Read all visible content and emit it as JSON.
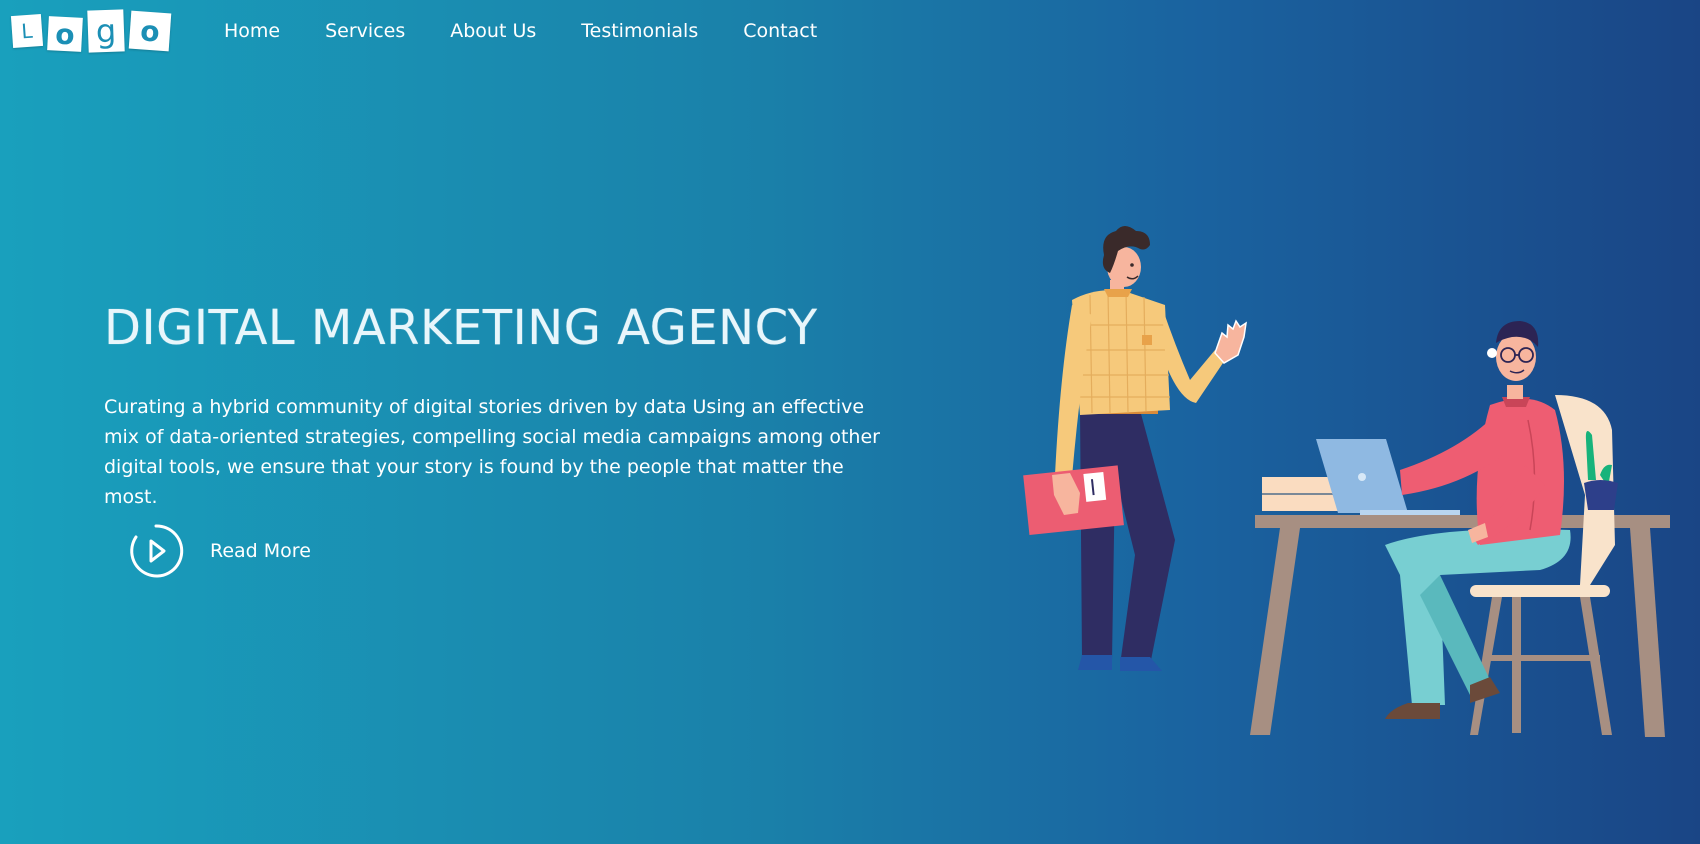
{
  "logo": {
    "letters": [
      "L",
      "o",
      "g",
      "o"
    ]
  },
  "nav": {
    "items": [
      "Home",
      "Services",
      "About Us",
      "Testimonials",
      "Contact"
    ]
  },
  "hero": {
    "title": "DIGITAL MARKETING AGENCY",
    "description": "Curating a hybrid community of digital stories driven by data Using an effective mix of data-oriented strategies, compelling social media campaigns among other digital tools, we ensure that your story is found by the people that matter the most.",
    "cta_label": "Read More",
    "cta_icon": "play-circle-icon"
  },
  "colors": {
    "gradient_start": "#19a0bd",
    "gradient_end": "#1a4585",
    "text": "#ffffff",
    "logo_letter": "#1b8fb5"
  }
}
